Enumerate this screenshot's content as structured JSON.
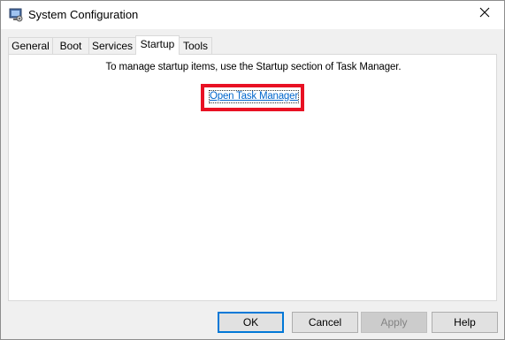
{
  "window": {
    "title": "System Configuration",
    "app_icon": "msconfig-icon",
    "close_glyph": "✕"
  },
  "tabs": [
    {
      "label": "General",
      "active": false
    },
    {
      "label": "Boot",
      "active": false
    },
    {
      "label": "Services",
      "active": false
    },
    {
      "label": "Startup",
      "active": true
    },
    {
      "label": "Tools",
      "active": false
    }
  ],
  "startup_panel": {
    "message": "To manage startup items, use the Startup section of Task Manager.",
    "link_label": "Open Task Manager",
    "highlight_color": "#e81123"
  },
  "buttons": {
    "ok": "OK",
    "cancel": "Cancel",
    "apply": "Apply",
    "help": "Help"
  },
  "colors": {
    "accent": "#0078d7",
    "link": "#0066cc"
  }
}
